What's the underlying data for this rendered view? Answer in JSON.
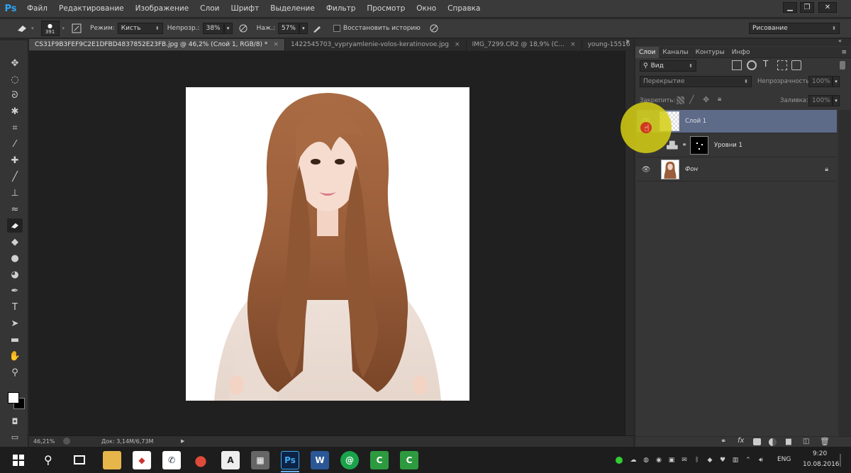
{
  "app": {
    "logo": "Ps"
  },
  "menu": [
    "Файл",
    "Редактирование",
    "Изображение",
    "Слои",
    "Шрифт",
    "Выделение",
    "Фильтр",
    "Просмотр",
    "Окно",
    "Справка"
  ],
  "window_controls": {
    "minimize": "▁",
    "restore": "❐",
    "close": "✕"
  },
  "options": {
    "brush_size": "391",
    "mode_label": "Режим:",
    "mode_value": "Кисть",
    "opacity_label": "Непрозр.:",
    "opacity_value": "38%",
    "pressure_label": "Наж.:",
    "pressure_value": "57%",
    "restore_history_label": "Восстановить историю",
    "workspace": "Рисование"
  },
  "doc_tabs": [
    {
      "label": "CS31F9B3FEF9C2E1DFBD4837852E23FB.jpg @ 46,2% (Слой 1, RGB/8) *",
      "close": "×"
    },
    {
      "label": "1422545703_vypryamlenie-volos-keratinovoe.jpg",
      "close": "×"
    },
    {
      "label": "IMG_7299.CR2 @ 18,9% (C...",
      "close": "×"
    },
    {
      "label": "young-15516",
      "close": ""
    }
  ],
  "tabs_overflow": "»",
  "status": {
    "zoom": "46,21%",
    "doc": "Док: 3,14M/6,73M"
  },
  "layers_panel": {
    "tabs": [
      "Слои",
      "Каналы",
      "Контуры",
      "Инфо"
    ],
    "filter_label": "Вид",
    "blend_mode": "Перекрытие",
    "opacity_label": "Непрозрачность:",
    "opacity_value": "100%",
    "lock_label": "Закрепить:",
    "fill_label": "Заливка:",
    "fill_value": "100%",
    "layers": [
      {
        "name": "Слой 1",
        "selected": true
      },
      {
        "name": "Уровни 1",
        "selected": false
      },
      {
        "name": "Фон",
        "selected": false
      }
    ]
  },
  "taskbar": {
    "apps": [
      {
        "name": "chrome",
        "glyph": "●",
        "color": "#e04a3a"
      },
      {
        "name": "acrobat",
        "glyph": "A",
        "color": "#222"
      },
      {
        "name": "calculator",
        "glyph": "▦",
        "color": "#666"
      },
      {
        "name": "photoshop",
        "glyph": "Ps",
        "color": "#0c2346"
      },
      {
        "name": "word",
        "glyph": "W",
        "color": "#2b5797"
      },
      {
        "name": "mail-agent",
        "glyph": "@",
        "color": "#1aa34a"
      },
      {
        "name": "camtasia",
        "glyph": "C",
        "color": "#2d9a3f"
      },
      {
        "name": "camtasia-recorder",
        "glyph": "C",
        "color": "#2d9a3f"
      }
    ],
    "lang": "ENG",
    "time": "9:20",
    "date": "10.08.2016"
  }
}
